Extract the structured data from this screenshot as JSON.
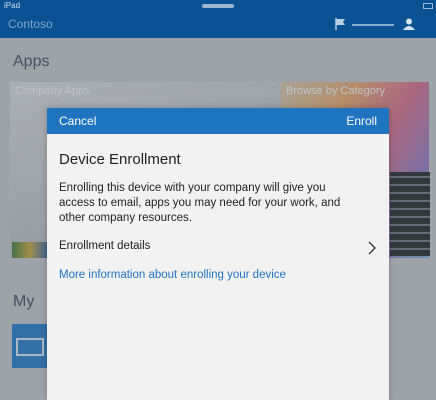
{
  "status_bar": {
    "device": "iPad"
  },
  "header": {
    "brand": "Contoso"
  },
  "background": {
    "apps_heading": "Apps",
    "tiles": [
      {
        "label": "Company Apps"
      },
      {
        "label": "Browse by Category"
      }
    ],
    "my_heading": "My"
  },
  "dialog": {
    "cancel_label": "Cancel",
    "enroll_label": "Enroll",
    "title": "Device Enrollment",
    "description": "Enrolling this device with your company will give you access to email, apps you may need for your work, and other company resources.",
    "details_label": "Enrollment details",
    "more_info_link": "More information about enrolling your device"
  },
  "colors": {
    "header_bg": "#0a5293",
    "dialog_bar": "#1f74bf",
    "link": "#1f74bf",
    "dialog_bg": "#f2f2f2"
  },
  "icons": [
    "flag-icon",
    "user-icon",
    "chevron-right-icon",
    "device-icon"
  ]
}
